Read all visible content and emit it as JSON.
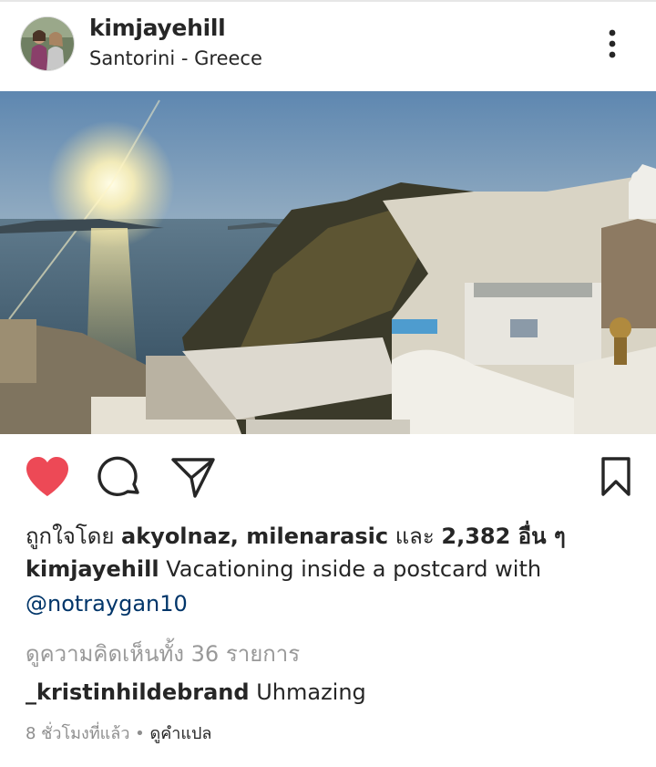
{
  "post": {
    "username": "kimjayehill",
    "location": "Santorini - Greece"
  },
  "icons": {
    "avatar": "profile-photo",
    "more": "vertical-ellipsis-icon",
    "like": "heart-filled-icon",
    "comment": "speech-bubble-icon",
    "share": "paper-plane-icon",
    "save": "bookmark-icon"
  },
  "colors": {
    "like": "#ed4956",
    "link": "#003569",
    "muted": "#999999"
  },
  "likes": {
    "prefix": "ถูกใจโดย ",
    "user1": "akyolnaz",
    "separator": ", ",
    "user2": "milenarasic",
    "and": " และ ",
    "others": "2,382 อื่น ๆ"
  },
  "caption": {
    "username": "kimjayehill",
    "text": " Vacationing inside a postcard with",
    "mention": "@notraygan10"
  },
  "view_comments": "ดูความคิดเห็นทั้ง 36 รายการ",
  "comment": {
    "username": "_kristinhildebrand",
    "text": " Uhmazing"
  },
  "meta": {
    "time": "8 ชั่วโมงที่แล้ว",
    "dot": " • ",
    "translate": "ดูคำแปล"
  }
}
